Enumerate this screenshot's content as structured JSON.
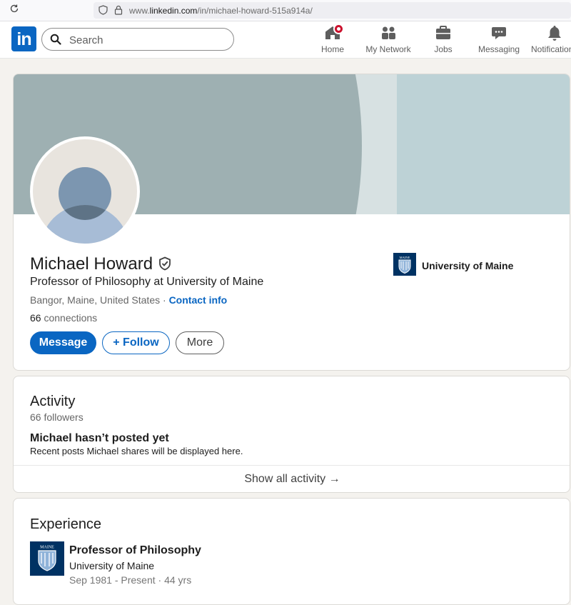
{
  "browser": {
    "url_prefix": "www.",
    "url_domain": "linkedin.com",
    "url_path": "/in/michael-howard-515a914a/"
  },
  "nav": {
    "logo_text": "in",
    "search_placeholder": "Search",
    "items": [
      {
        "label": "Home",
        "icon": "home-icon"
      },
      {
        "label": "My Network",
        "icon": "network-icon"
      },
      {
        "label": "Jobs",
        "icon": "briefcase-icon"
      },
      {
        "label": "Messaging",
        "icon": "chat-icon"
      },
      {
        "label": "Notifications",
        "icon": "bell-icon"
      }
    ]
  },
  "profile": {
    "name": "Michael Howard",
    "headline": "Professor of Philosophy at University of Maine",
    "location": "Bangor, Maine, United States",
    "separator": " · ",
    "contact_label": "Contact info",
    "connections_count": "66",
    "connections_label": " connections",
    "buttons": {
      "message": "Message",
      "follow": "+ Follow",
      "more": "More"
    },
    "school": "University of Maine",
    "school_logo_text": "MAINE"
  },
  "activity": {
    "title": "Activity",
    "followers": "66 followers",
    "empty_title": "Michael hasn’t posted yet",
    "empty_subtitle": "Recent posts Michael shares will be displayed here.",
    "show_all": "Show all activity →"
  },
  "experience": {
    "title": "Experience",
    "items": [
      {
        "title": "Professor of Philosophy",
        "company": "University of Maine",
        "dates": "Sep 1981 - Present · 44 yrs",
        "logo_text": "MAINE"
      }
    ]
  },
  "colors": {
    "brand": "#0a66c2",
    "notification_badge": "#cb112d",
    "maine_navy": "#003263"
  }
}
